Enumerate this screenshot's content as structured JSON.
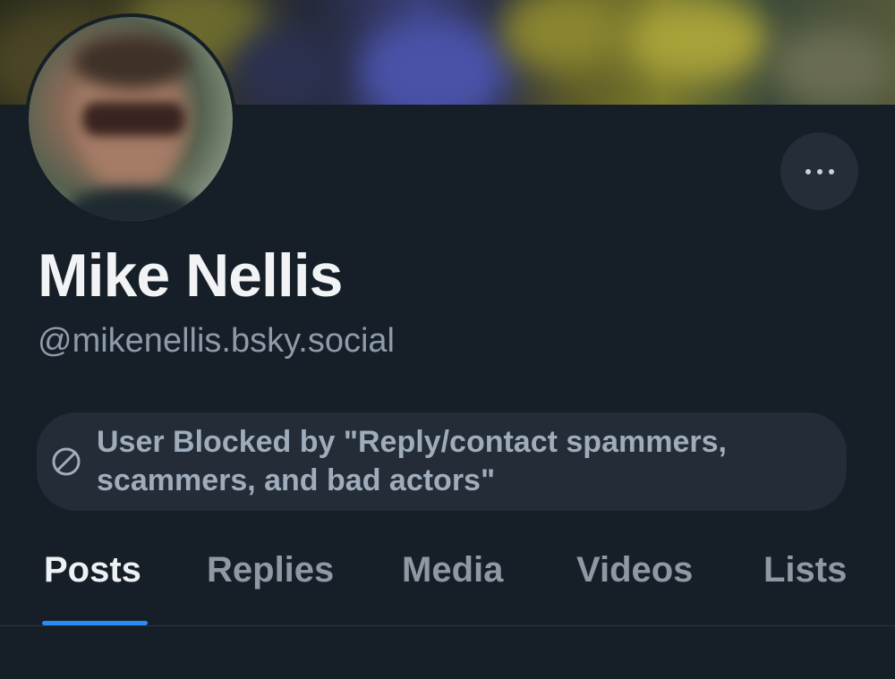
{
  "profile": {
    "display_name": "Mike Nellis",
    "handle": "@mikenellis.bsky.social"
  },
  "moderation": {
    "icon": "ban-icon",
    "notice": "User Blocked by \"Reply/contact spammers, scammers, and bad actors\""
  },
  "actions": {
    "more_icon": "ellipsis-icon"
  },
  "tabs": [
    {
      "label": "Posts",
      "active": true
    },
    {
      "label": "Replies",
      "active": false
    },
    {
      "label": "Media",
      "active": false
    },
    {
      "label": "Videos",
      "active": false
    },
    {
      "label": "Lists",
      "active": false
    }
  ],
  "colors": {
    "background": "#161e27",
    "accent": "#2a8af6",
    "notice_bg": "#232c37"
  }
}
